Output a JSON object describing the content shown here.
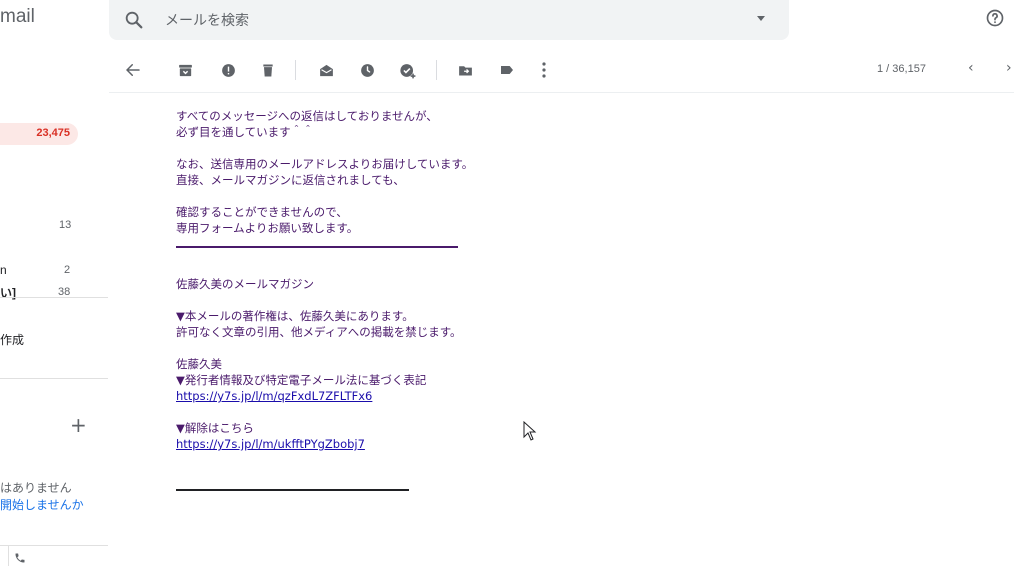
{
  "sidebar": {
    "logo": "mail",
    "inbox_count": "23,475",
    "counts": [
      "13",
      "2",
      "38"
    ],
    "fragments": [
      "n",
      "い]",
      "作成"
    ],
    "hangouts_line1": "はありません",
    "hangouts_line2": "開始しませんか"
  },
  "search": {
    "placeholder": "メールを検索"
  },
  "toolbar": {
    "pager": "1 / 36,157",
    "prev": "‹",
    "next": "›"
  },
  "message": {
    "line1": "すべてのメッセージへの返信はしておりませんが、",
    "line2": "必ず目を通しています＾＾",
    "line3": "なお、送信専用のメールアドレスよりお届けしています。",
    "line4": "直接、メールマガジンに返信されましても、",
    "line5": "確認することができませんので、",
    "line6": "専用フォームよりお願い致します。",
    "magazine_title": "佐藤久美のメールマガジン",
    "copyright1": "▼本メールの著作権は、佐藤久美にあります。",
    "copyright2": "許可なく文章の引用、他メディアへの掲載を禁じます。",
    "publisher": "佐藤久美",
    "publisher_note": "▼発行者情報及び特定電子メール法に基づく表記",
    "publisher_link": "https://y7s.jp/l/m/qzFxdL7ZFLTFx6",
    "unsubscribe_label": "▼解除はこちら",
    "unsubscribe_link": "https://y7s.jp/l/m/ukfftPYgZbobj7"
  },
  "colors": {
    "accent_red": "#d93025",
    "text_purple": "#4a1a6b",
    "link": "#1a0dab"
  }
}
